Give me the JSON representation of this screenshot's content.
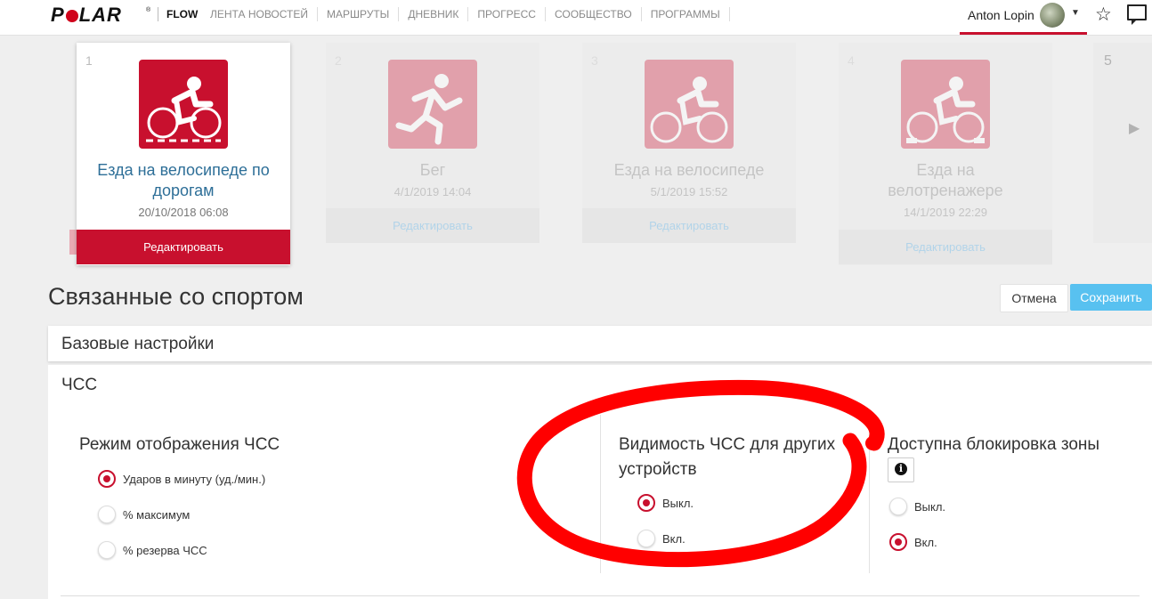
{
  "brand": {
    "logo": "POLAR",
    "reg": "®",
    "app": "FLOW"
  },
  "nav": [
    "ЛЕНТА НОВОСТЕЙ",
    "МАРШРУТЫ",
    "ДНЕВНИК",
    "ПРОГРЕСС",
    "СООБЩЕСТВО",
    "ПРОГРАММЫ"
  ],
  "user": {
    "name": "Anton Lopin"
  },
  "sports": [
    {
      "num": "1",
      "title_line1": "Езда на велосипеде по",
      "title_line2": "дорогам",
      "date": "20/10/2018   06:08",
      "edit": "Редактировать",
      "icon": "road-cycling-icon"
    },
    {
      "num": "2",
      "title_line1": "Бег",
      "title_line2": "",
      "date": "4/1/2019   14:04",
      "edit": "Редактировать",
      "icon": "running-icon"
    },
    {
      "num": "3",
      "title_line1": "Езда на велосипеде",
      "title_line2": "",
      "date": "5/1/2019   15:52",
      "edit": "Редактировать",
      "icon": "cycling-icon"
    },
    {
      "num": "4",
      "title_line1": "Езда на",
      "title_line2": "велотренажере",
      "date": "14/1/2019   22:29",
      "edit": "Редактировать",
      "icon": "indoor-cycling-icon"
    },
    {
      "num": "5",
      "title_line1": "",
      "title_line2": "",
      "date": "",
      "edit": "",
      "icon": ""
    }
  ],
  "section": {
    "title": "Связанные со спортом",
    "cancel": "Отмена",
    "save": "Сохранить"
  },
  "panels": {
    "basic": "Базовые настройки",
    "hr": "ЧСС"
  },
  "hr_display": {
    "title": "Режим отображения ЧСС",
    "options": [
      {
        "label": "Ударов в минуту (уд./мин.)",
        "selected": true
      },
      {
        "label": "% максимум",
        "selected": false
      },
      {
        "label": "% резерва ЧСС",
        "selected": false
      }
    ]
  },
  "hr_visibility": {
    "title_line1": "Видимость ЧСС для других",
    "title_line2": "устройств",
    "options": [
      {
        "label": "Выкл.",
        "selected": true
      },
      {
        "label": "Вкл.",
        "selected": false
      }
    ]
  },
  "zone_lock": {
    "title": "Доступна блокировка зоны",
    "info": "i",
    "options": [
      {
        "label": "Выкл.",
        "selected": false
      },
      {
        "label": "Вкл.",
        "selected": true
      }
    ]
  },
  "colors": {
    "accent": "#c8102e",
    "save": "#58c1f0",
    "link": "#2e6f98",
    "annotation": "#ff0000"
  }
}
